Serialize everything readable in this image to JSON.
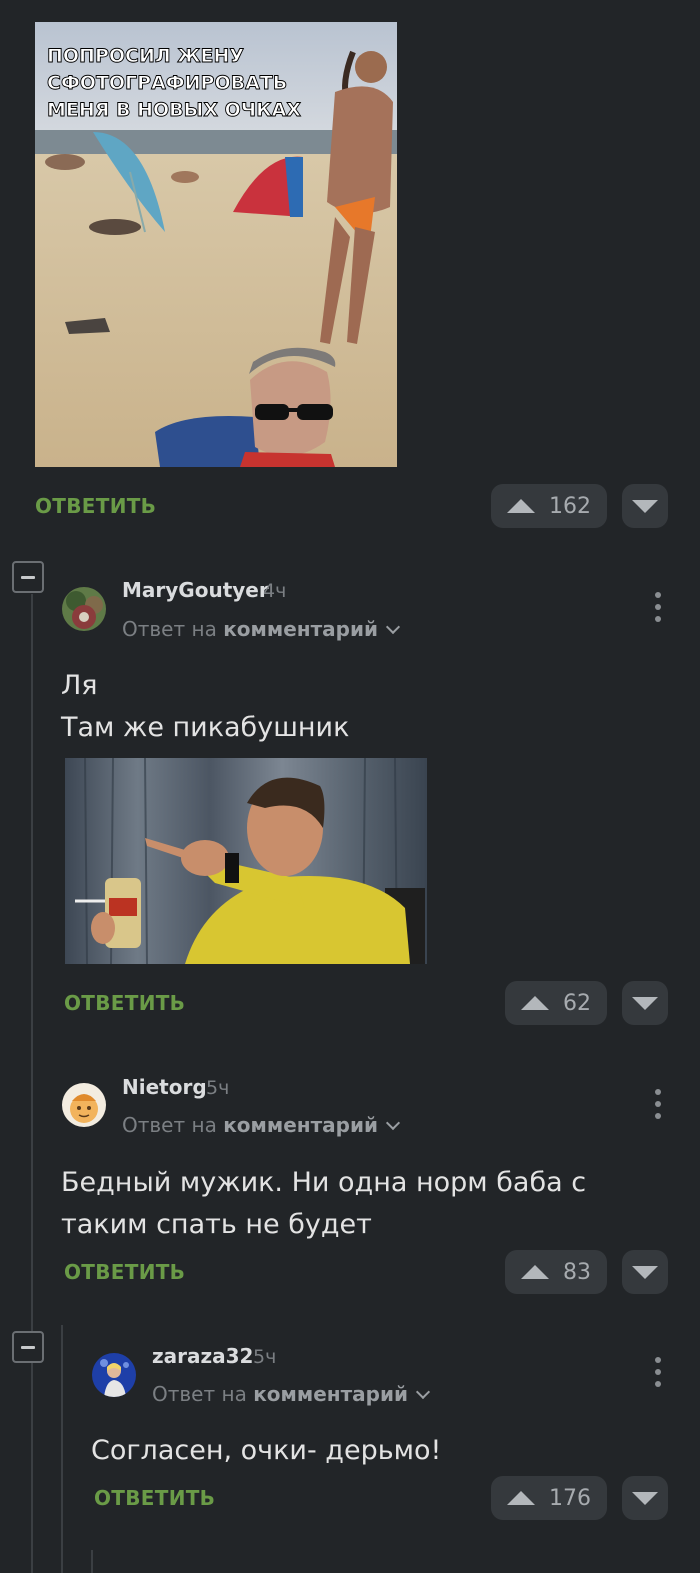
{
  "post_image": {
    "caption_lines": [
      "ПОПРОСИЛ ЖЕНУ",
      "СФОТОГРАФИРОВАТЬ",
      "МЕНЯ В НОВЫХ ОЧКАХ"
    ]
  },
  "top_comment": {
    "reply_label": "ОТВЕТИТЬ",
    "votes": "162"
  },
  "comments": [
    {
      "username": "MaryGoutyer",
      "time": "4ч",
      "reply_prefix": "Ответ на",
      "reply_target": "комментарий",
      "text_lines": [
        "Ля",
        "Там же пикабушник"
      ],
      "reply_label": "ОТВЕТИТЬ",
      "votes": "62"
    },
    {
      "username": "Nietorg",
      "time": "5ч",
      "reply_prefix": "Ответ на",
      "reply_target": "комментарий",
      "text_lines": [
        "Бедный мужик. Ни одна норм баба с",
        "таким спать не будет"
      ],
      "reply_label": "ОТВЕТИТЬ",
      "votes": "83"
    },
    {
      "username": "zaraza32",
      "time": "5ч",
      "reply_prefix": "Ответ на",
      "reply_target": "комментарий",
      "text_lines": [
        "Согласен, очки- дерьмо!"
      ],
      "reply_label": "ОТВЕТИТЬ",
      "votes": "176"
    }
  ],
  "colors": {
    "background": "#222528",
    "reply_green": "#6a9b47",
    "vote_bg": "#35393d"
  },
  "icons": [
    "collapse-icon",
    "upvote-icon",
    "downvote-icon",
    "more-icon",
    "chevron-down-icon"
  ]
}
